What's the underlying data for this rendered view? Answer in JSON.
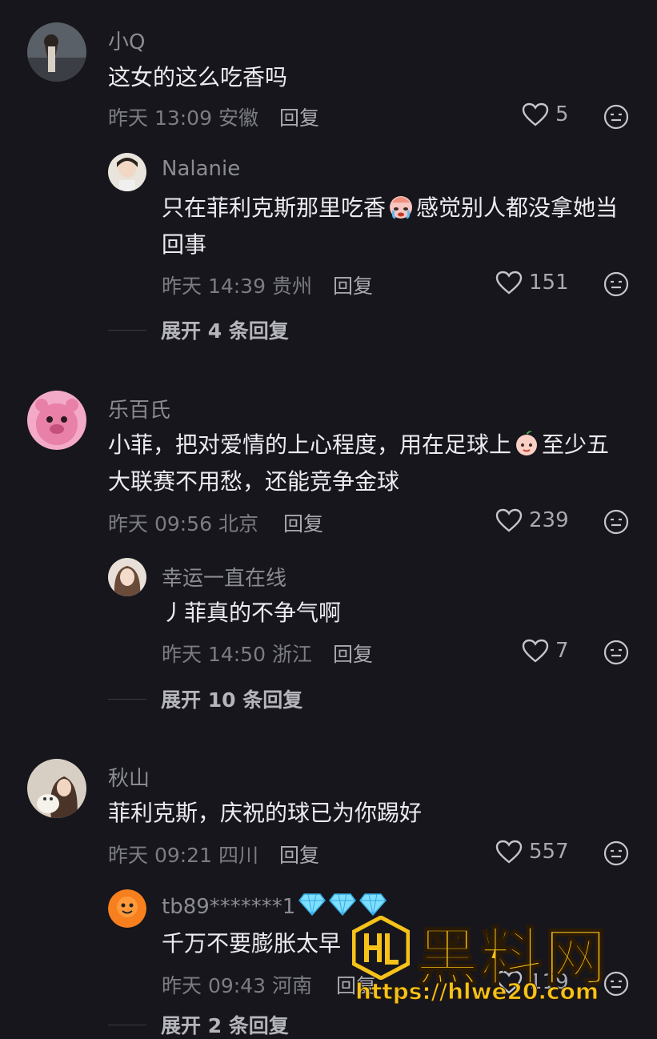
{
  "comments": [
    {
      "name": "小Q",
      "text": "这女的这么吃香吗",
      "time": "昨天 13:09 安徽",
      "reply_label": "回复",
      "likes": "5",
      "replies": [
        {
          "name": "Nalanie",
          "text_before": "只在菲利克斯那里吃香",
          "emoji": "crying-face",
          "text_after": "感觉别人都没拿她当",
          "text_line2": "回事",
          "time": "昨天 14:39 贵州",
          "reply_label": "回复",
          "likes": "151"
        }
      ],
      "expand_label": "展开 4 条回复"
    },
    {
      "name": "乐百氏",
      "text_before": "小菲，把对爱情的上心程度，用在足球上",
      "emoji": "peach-face",
      "text_after": "至少五",
      "text_line2": "大联赛不用愁，还能竞争金球",
      "time": "昨天 09:56 北京",
      "reply_label": "回复",
      "likes": "239",
      "replies": [
        {
          "name": "幸运一直在线",
          "text": "丿菲真的不争气啊",
          "time": "昨天 14:50 浙江",
          "reply_label": "回复",
          "likes": "7"
        }
      ],
      "expand_label": "展开 10 条回复"
    },
    {
      "name": "秋山",
      "text": "菲利克斯，庆祝的球已为你踢好",
      "time": "昨天 09:21 四川",
      "reply_label": "回复",
      "likes": "557",
      "replies": [
        {
          "name": "tb89*******1",
          "badges": [
            "diamond",
            "diamond",
            "diamond"
          ],
          "text": "千万不要膨胀太早",
          "time": "昨天 09:43 河南",
          "reply_label": "回复",
          "likes": "119"
        }
      ],
      "expand_label": "展开 2 条回复"
    }
  ],
  "watermark": {
    "title": "黑料网",
    "url": "https://hlwe20.com"
  },
  "colors": {
    "background": "#16161c",
    "text": "#ececf0",
    "muted": "#7c7c84",
    "watermark": "#f6c21a"
  }
}
